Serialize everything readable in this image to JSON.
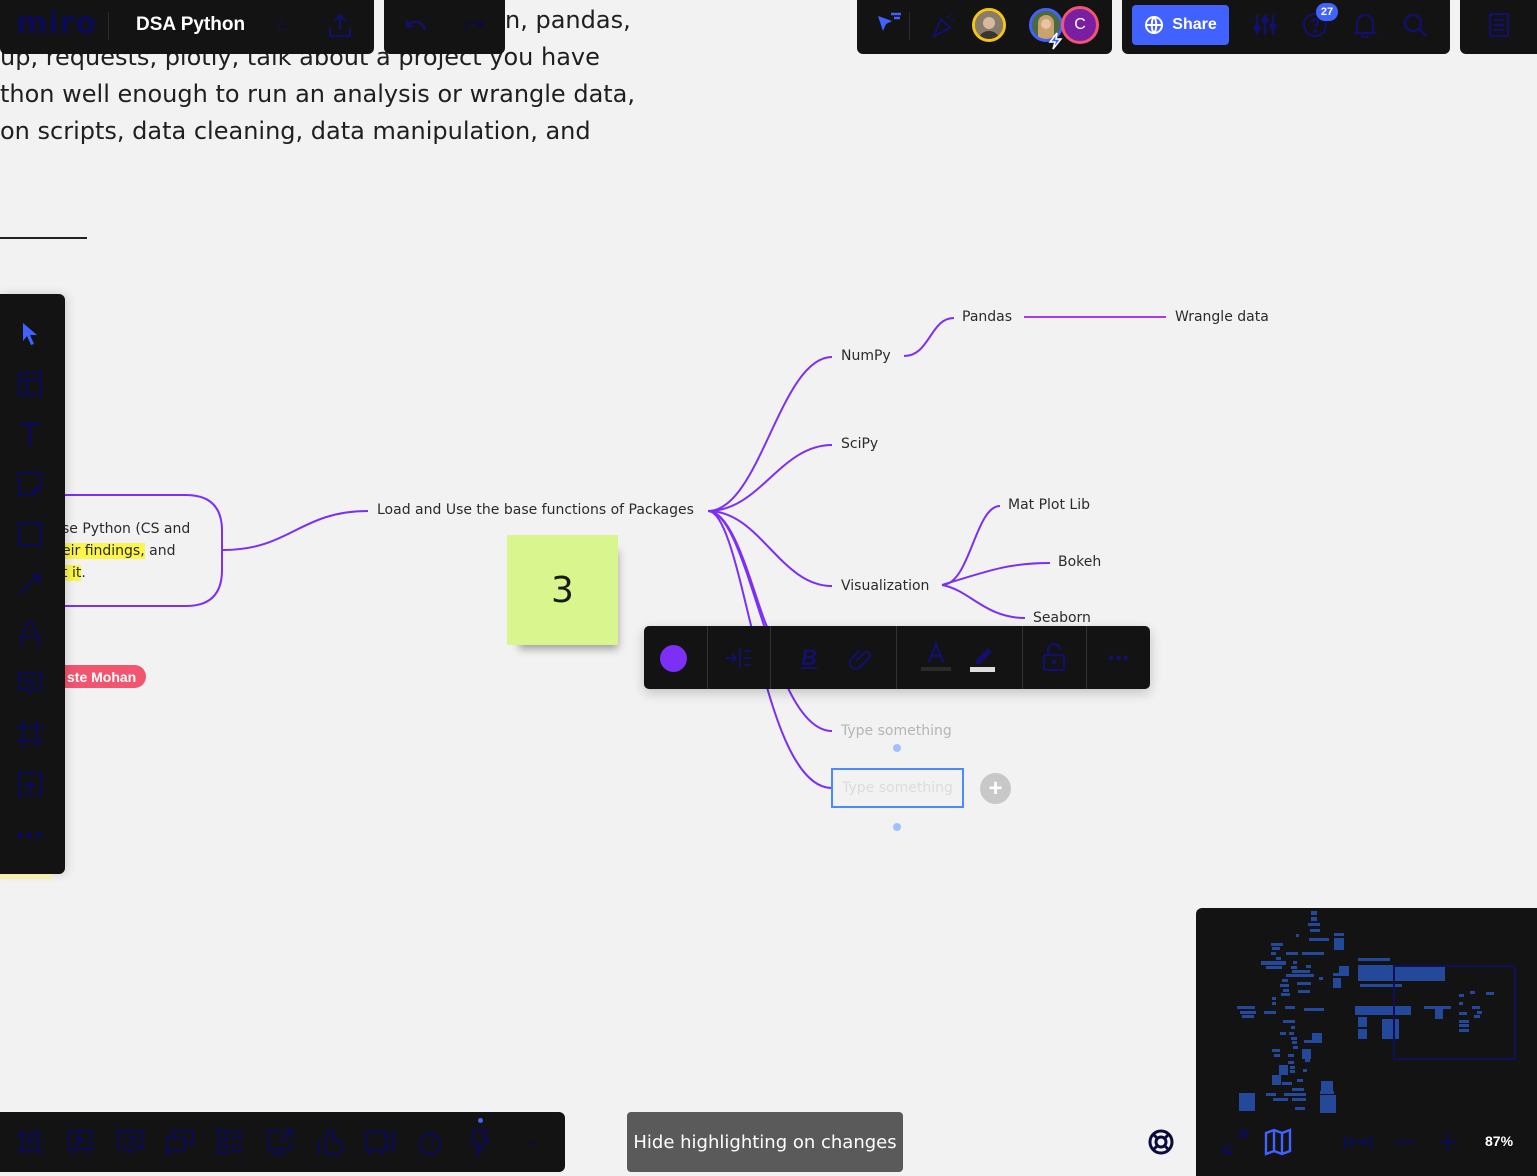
{
  "app": {
    "logo": "miro",
    "board_title": "DSA Python"
  },
  "header": {
    "share_label": "Share",
    "notifications_count": "27",
    "collaborator_initial": "C"
  },
  "background_text": {
    "lines": [
      "n, pandas,",
      "up, requests, plotly, talk about a project you have",
      "thon well enough to run an analysis or wrangle data,",
      "on scripts, data cleaning, data manipulation, and"
    ]
  },
  "left_card": {
    "line1": "se Python (CS and",
    "line2_highlight": "eir findings,",
    "line2_rest": " and",
    "line3_highlight": "t it",
    "line3_rest": "."
  },
  "cursor_tag": "ste Mohan",
  "mindmap": {
    "root": "Load and Use the base functions of Packages",
    "nodes": {
      "numpy": "NumPy",
      "pandas": "Pandas",
      "wrangle": "Wrangle data",
      "scipy": "SciPy",
      "visualization": "Visualization",
      "matplotlib": "Mat Plot Lib",
      "bokeh": "Bokeh",
      "seaborn": "Seaborn",
      "placeholder1": "Type something",
      "placeholder2": "Type something"
    },
    "line_color": "#7b2ff7"
  },
  "sticky_note": {
    "text": "3",
    "color": "#d8f58e"
  },
  "context_toolbar": {
    "color": "#7b2ff7"
  },
  "bottom": {
    "hide_highlighting": "Hide highlighting on changes",
    "zoom": "87%"
  },
  "colors": {
    "accent": "#4262ff",
    "panel": "#131313",
    "icon_dim": "#12106a"
  }
}
